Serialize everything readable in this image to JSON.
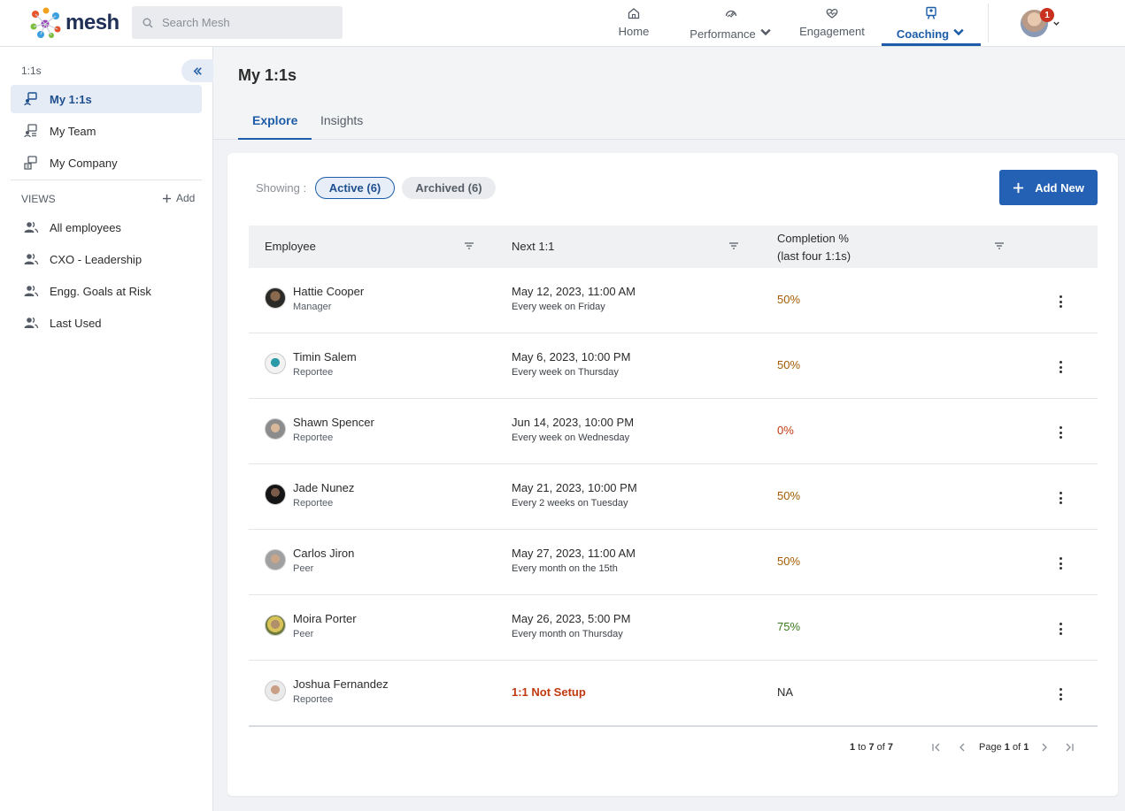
{
  "brand": {
    "name": "mesh"
  },
  "search": {
    "placeholder": "Search Mesh"
  },
  "topnav": {
    "items": [
      {
        "label": "Home",
        "icon": "home-icon"
      },
      {
        "label": "Performance",
        "icon": "gauge-icon",
        "dropdown": true
      },
      {
        "label": "Engagement",
        "icon": "heart-pulse-icon"
      },
      {
        "label": "Coaching",
        "icon": "coaching-icon",
        "dropdown": true,
        "active": true
      }
    ],
    "notification_count": "1"
  },
  "sidebar": {
    "section_title": "1:1s",
    "items": [
      {
        "label": "My 1:1s",
        "active": true
      },
      {
        "label": "My Team"
      },
      {
        "label": "My Company"
      }
    ],
    "views_title": "VIEWS",
    "views_add": "Add",
    "views": [
      {
        "label": "All employees"
      },
      {
        "label": "CXO - Leadership"
      },
      {
        "label": "Engg. Goals at Risk"
      },
      {
        "label": "Last Used"
      }
    ]
  },
  "page": {
    "title": "My 1:1s",
    "tabs": [
      {
        "label": "Explore",
        "active": true
      },
      {
        "label": "Insights"
      }
    ]
  },
  "filters": {
    "showing_label": "Showing :",
    "active_label": "Active (6)",
    "archived_label": "Archived (6)"
  },
  "add_new_label": "Add New",
  "table": {
    "columns": {
      "employee": "Employee",
      "next": "Next 1:1",
      "completion_line1": "Completion %",
      "completion_line2": "(last four 1:1s)"
    },
    "rows": [
      {
        "name": "Hattie Cooper",
        "role": "Manager",
        "date": "May 12, 2023, 11:00 AM",
        "freq": "Every week on Friday",
        "pct": "50%",
        "pct_color": "#a35a00"
      },
      {
        "name": "Timin Salem",
        "role": "Reportee",
        "date": "May 6, 2023, 10:00 PM",
        "freq": "Every week on Thursday",
        "pct": "50%",
        "pct_color": "#a35a00"
      },
      {
        "name": "Shawn Spencer",
        "role": "Reportee",
        "date": "Jun 14, 2023, 10:00 PM",
        "freq": "Every week on Wednesday",
        "pct": "0%",
        "pct_color": "#c0390f"
      },
      {
        "name": "Jade Nunez",
        "role": "Reportee",
        "date": "May 21, 2023, 10:00 PM",
        "freq": "Every 2 weeks on Tuesday",
        "pct": "50%",
        "pct_color": "#a35a00"
      },
      {
        "name": "Carlos Jiron",
        "role": "Peer",
        "date": "May 27, 2023, 11:00 AM",
        "freq": "Every month on the 15th",
        "pct": "50%",
        "pct_color": "#a35a00"
      },
      {
        "name": "Moira Porter",
        "role": "Peer",
        "date": "May 26, 2023, 5:00 PM",
        "freq": "Every month on Thursday",
        "pct": "75%",
        "pct_color": "#3a7a1c"
      },
      {
        "name": "Joshua Fernandez",
        "role": "Reportee",
        "not_setup": "1:1 Not Setup",
        "pct": "NA",
        "pct_color": "#2b2b2b"
      }
    ]
  },
  "pagination": {
    "range_from": "1",
    "range_to": "7",
    "total": "7",
    "to_word": "to",
    "of_word": "of",
    "page_word": "Page",
    "page": "1",
    "pages": "1"
  },
  "colors": {
    "accent": "#1d5ca8",
    "button": "#2461b4",
    "warn": "#a35a00",
    "danger": "#c0390f",
    "success": "#3a7a1c"
  }
}
